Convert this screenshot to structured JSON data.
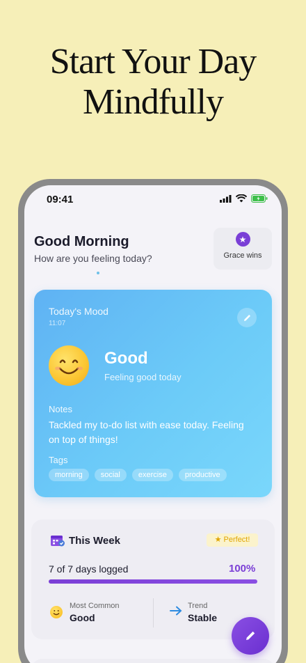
{
  "headline": {
    "line1": "Start Your Day",
    "line2": "Mindfully"
  },
  "status_bar": {
    "time": "09:41"
  },
  "greeting": {
    "title": "Good Morning",
    "subtitle": "How are you feeling today?"
  },
  "badge": {
    "label": "Grace wins",
    "icon": "star-icon"
  },
  "mood_card": {
    "title": "Today's Mood",
    "time": "11:07",
    "mood": "Good",
    "mood_subtitle": "Feeling good today",
    "notes_heading": "Notes",
    "notes": "Tackled my to-do list with ease today. Feeling on top of things!",
    "tags_heading": "Tags",
    "tags": [
      "morning",
      "social",
      "exercise",
      "productive"
    ]
  },
  "week_card": {
    "title": "This Week",
    "badge": "Perfect!",
    "days_logged": "7 of 7 days logged",
    "percent_label": "100%",
    "progress": 1.0,
    "most_common_label": "Most Common",
    "most_common_value": "Good",
    "trend_label": "Trend",
    "trend_value": "Stable"
  },
  "colors": {
    "accent": "#7b3fd6",
    "mood_card": "#6cc4f7",
    "background": "#f6efb8"
  }
}
